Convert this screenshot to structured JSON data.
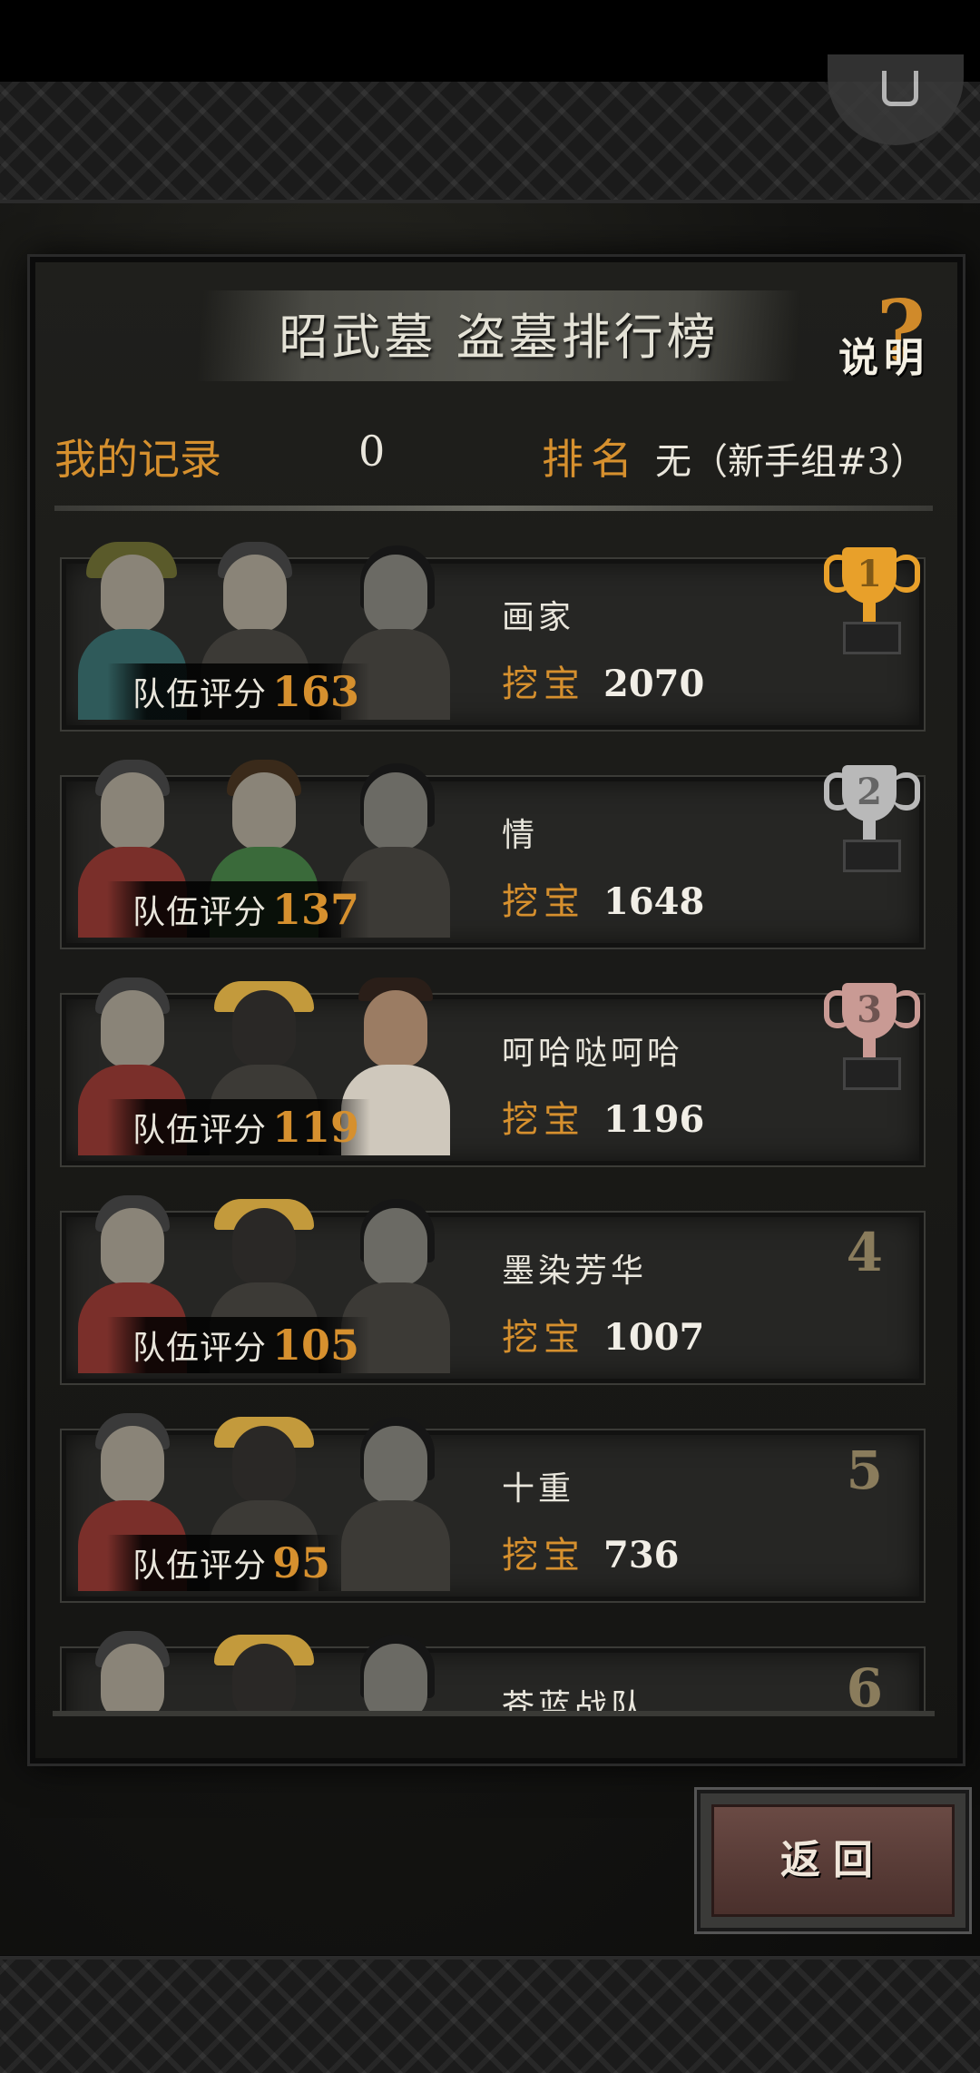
{
  "title": "昭武墓 盗墓排行榜",
  "help_label": "说明",
  "help_glyph": "?",
  "my_record": {
    "label": "我的记录",
    "value": "0",
    "rank_label": "排名",
    "rank_value": "无（新手组#3）"
  },
  "score_label": "队伍评分",
  "dig_label": "挖宝",
  "entries": [
    {
      "rank": "1",
      "name": "画家",
      "team_score": "163",
      "treasure": "2070",
      "trophy": "gold"
    },
    {
      "rank": "2",
      "name": "情",
      "team_score": "137",
      "treasure": "1648",
      "trophy": "silver"
    },
    {
      "rank": "3",
      "name": "呵哈哒呵哈",
      "team_score": "119",
      "treasure": "1196",
      "trophy": "bronze"
    },
    {
      "rank": "4",
      "name": "墨染芳华",
      "team_score": "105",
      "treasure": "1007"
    },
    {
      "rank": "5",
      "name": "十重",
      "team_score": "95",
      "treasure": "736"
    },
    {
      "rank": "6",
      "name": "苍蓝战队"
    }
  ],
  "back_button": "返回"
}
